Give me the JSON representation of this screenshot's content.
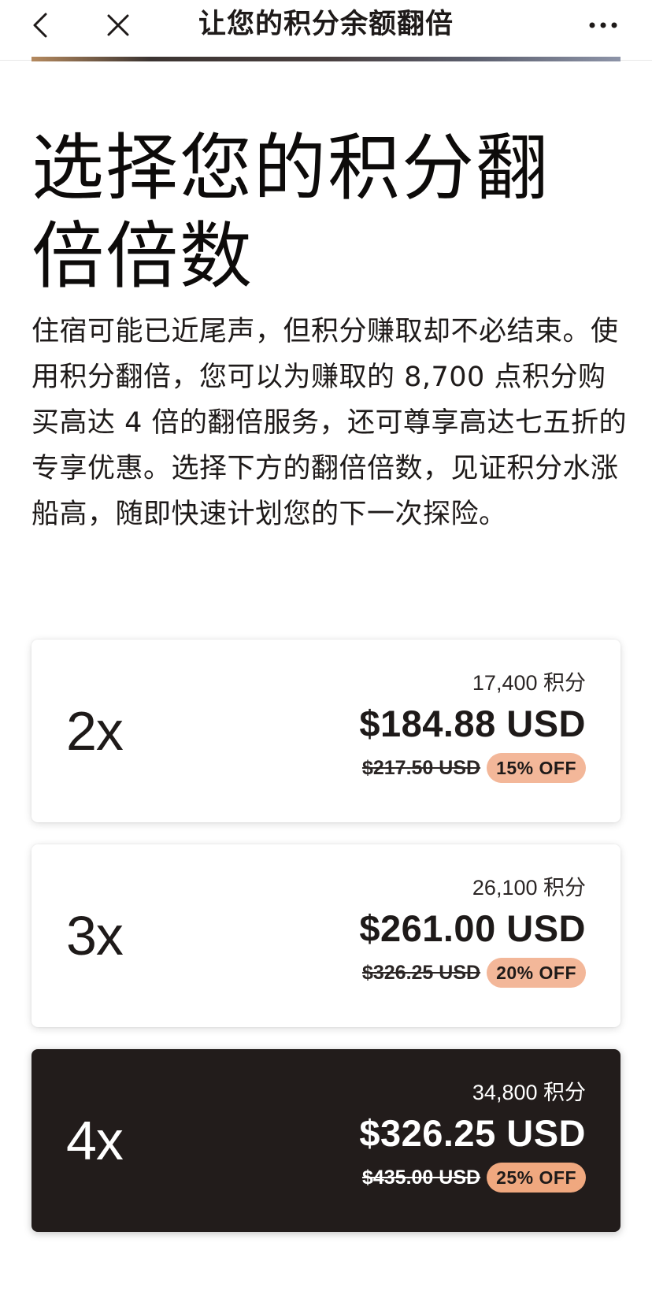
{
  "nav": {
    "title": "让您的积分余额翻倍",
    "back_icon": "chevron-left-icon",
    "close_icon": "close-icon",
    "more_icon": "more-horizontal-icon"
  },
  "heading": "选择您的积分翻倍倍数",
  "description": "住宿可能已近尾声，但积分赚取却不必结束。使用积分翻倍，您可以为赚取的 8,700 点积分购买高达 4 倍的翻倍服务，还可尊享高达七五折的专享优惠。选择下方的翻倍倍数，见证积分水涨船高，随即快速计划您的下一次探险。",
  "options": [
    {
      "multiplier": "2x",
      "points": "17,400 积分",
      "price": "$184.88 USD",
      "original_price": "$217.50 USD",
      "discount": "15% OFF",
      "selected": false
    },
    {
      "multiplier": "3x",
      "points": "26,100 积分",
      "price": "$261.00 USD",
      "original_price": "$326.25 USD",
      "discount": "20% OFF",
      "selected": false
    },
    {
      "multiplier": "4x",
      "points": "34,800 积分",
      "price": "$326.25 USD",
      "original_price": "$435.00 USD",
      "discount": "25% OFF",
      "selected": true
    }
  ],
  "colors": {
    "text": "#1e1a19",
    "selected_card": "#221c1b",
    "badge": "#f3b799",
    "badge_selected": "#f0a87f"
  }
}
